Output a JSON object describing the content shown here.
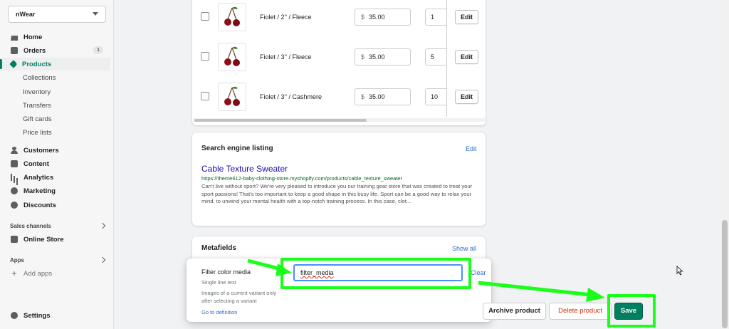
{
  "sidebar": {
    "store_name": "nWear",
    "nav": [
      {
        "label": "Home",
        "icon": "home-icon"
      },
      {
        "label": "Orders",
        "icon": "orders-icon",
        "badge": "1"
      },
      {
        "label": "Products",
        "icon": "tag-icon",
        "active": true
      },
      {
        "label": "Collections"
      },
      {
        "label": "Inventory"
      },
      {
        "label": "Transfers"
      },
      {
        "label": "Gift cards"
      },
      {
        "label": "Price lists"
      },
      {
        "label": "Customers",
        "icon": "person-icon"
      },
      {
        "label": "Content",
        "icon": "content-icon"
      },
      {
        "label": "Analytics",
        "icon": "analytics-icon"
      },
      {
        "label": "Marketing",
        "icon": "marketing-icon"
      },
      {
        "label": "Discounts",
        "icon": "discounts-icon"
      }
    ],
    "sales_channels_title": "Sales channels",
    "online_store": "Online Store",
    "apps_title": "Apps",
    "add_apps": "Add apps",
    "settings": "Settings"
  },
  "variants": [
    {
      "name": "Fiolet / 2'' / Fleece",
      "currency": "$",
      "price": "35.00",
      "qty": "1",
      "edit": "Edit"
    },
    {
      "name": "Fiolet / 3'' / Fleece",
      "currency": "$",
      "price": "35.00",
      "qty": "5",
      "edit": "Edit"
    },
    {
      "name": "Fiolet / 3'' / Cashmere",
      "currency": "$",
      "price": "35.00",
      "qty": "10",
      "edit": "Edit"
    }
  ],
  "seo": {
    "heading": "Search engine listing",
    "edit": "Edit",
    "title": "Cable Texture Sweater",
    "url": "https://theme612-baby-clothing-store.myshopify.com/products/cable_texture_sweater",
    "description": "Can't live without sport? We're very pleased to introduce you our training gear store that was created to treat your sport passions! That's too important to keep a good shape in this busy life. Sport can be a good way to relax your mind, to unwind your mental health with a top-notch training process. In this case, clot..."
  },
  "metafields": {
    "heading": "Metafields",
    "show_all": "Show all",
    "field_label": "Filter color media",
    "field_type": "Single line text",
    "field_description": "Images of a current variant only after selecting a variant",
    "definition_link": "Go to definition",
    "value": "filter_media",
    "clear": "Clear"
  },
  "actions": {
    "archive": "Archive product",
    "delete": "Delete product",
    "save": "Save"
  },
  "colors": {
    "brand": "#008060",
    "highlight": "#1aff1a",
    "link": "#2c6ecb",
    "danger": "#d72c0d"
  }
}
